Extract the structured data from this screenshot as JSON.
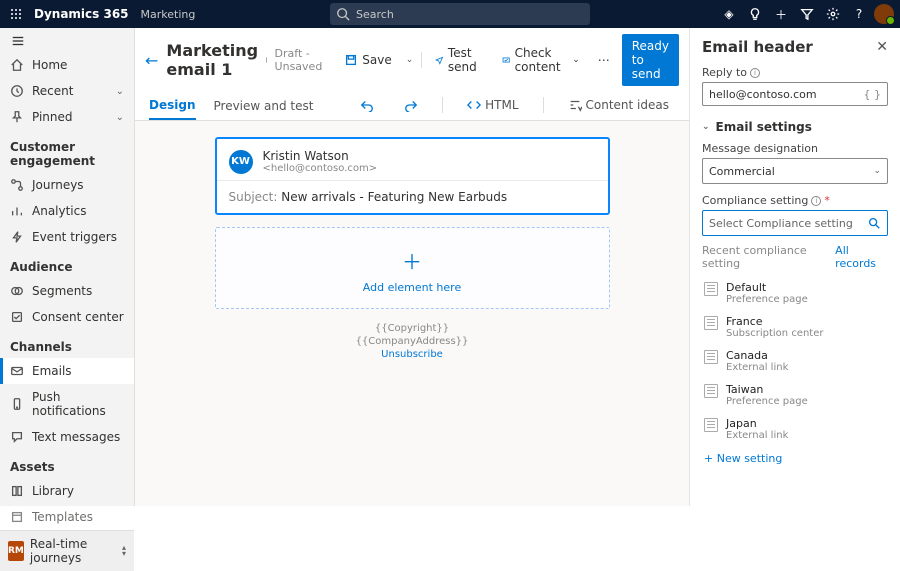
{
  "topbar": {
    "app": "Dynamics 365",
    "area": "Marketing",
    "search_placeholder": "Search"
  },
  "sidebar": {
    "home": "Home",
    "recent": "Recent",
    "pinned": "Pinned",
    "sections": {
      "engagement": "Customer engagement",
      "audience": "Audience",
      "channels": "Channels",
      "assets": "Assets"
    },
    "items": {
      "journeys": "Journeys",
      "analytics": "Analytics",
      "triggers": "Event triggers",
      "segments": "Segments",
      "consent": "Consent center",
      "emails": "Emails",
      "push": "Push notifications",
      "text": "Text messages",
      "library": "Library",
      "templates": "Templates"
    },
    "area_switcher": {
      "badge": "RM",
      "label": "Real-time journeys"
    }
  },
  "cmdbar": {
    "title": "Marketing email 1",
    "status": "Draft - Unsaved",
    "save": "Save",
    "test": "Test send",
    "check": "Check content",
    "ready": "Ready to send"
  },
  "tabs": {
    "design": "Design",
    "preview": "Preview and test",
    "html": "HTML",
    "ideas": "Content ideas"
  },
  "email": {
    "initials": "KW",
    "name": "Kristin Watson",
    "address": "<hello@contoso.com>",
    "subject_label": "Subject:",
    "subject_value": "New arrivals - Featuring New Earbuds",
    "add_element": "Add element here",
    "copyright": "{{Copyright}}",
    "company": "{{CompanyAddress}}",
    "unsubscribe": "Unsubscribe"
  },
  "panel": {
    "title": "Email header",
    "reply_to_label": "Reply to",
    "reply_to_value": "hello@contoso.com",
    "settings_hdr": "Email settings",
    "designation_label": "Message designation",
    "designation_value": "Commercial",
    "compliance_label": "Compliance setting",
    "compliance_placeholder": "Select Compliance setting",
    "recent_label": "Recent compliance setting",
    "all_label": "All records",
    "records": [
      {
        "title": "Default",
        "subtitle": "Preference page"
      },
      {
        "title": "France",
        "subtitle": "Subscription center"
      },
      {
        "title": "Canada",
        "subtitle": "External link"
      },
      {
        "title": "Taiwan",
        "subtitle": "Preference page"
      },
      {
        "title": "Japan",
        "subtitle": "External link"
      }
    ],
    "new_setting": "+ New setting"
  }
}
